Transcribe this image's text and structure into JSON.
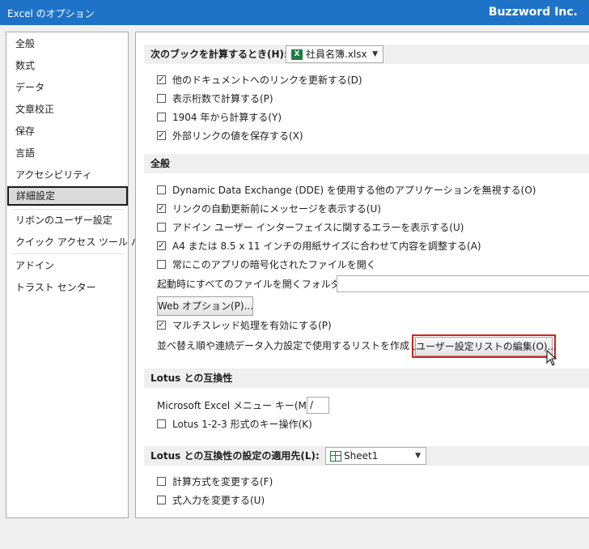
{
  "window": {
    "title": "Excel のオプション",
    "brand": "Buzzword Inc."
  },
  "sidebar": {
    "items": [
      {
        "label": "全般"
      },
      {
        "label": "数式"
      },
      {
        "label": "データ"
      },
      {
        "label": "文章校正"
      },
      {
        "label": "保存"
      },
      {
        "label": "言語"
      },
      {
        "label": "アクセシビリティ"
      },
      {
        "label": "詳細設定",
        "selected": true
      },
      {
        "label": "リボンのユーザー設定"
      },
      {
        "label": "クイック アクセス ツール バー"
      },
      {
        "label": "アドイン"
      },
      {
        "label": "トラスト センター"
      }
    ]
  },
  "workbook_section": {
    "header": "次のブックを計算するとき(H):",
    "workbook_value": "社員名簿.xlsx",
    "options": [
      {
        "label": "他のドキュメントへのリンクを更新する(D)",
        "checked": true
      },
      {
        "label": "表示桁数で計算する(P)",
        "checked": false
      },
      {
        "label": "1904 年から計算する(Y)",
        "checked": false
      },
      {
        "label": "外部リンクの値を保存する(X)",
        "checked": true
      }
    ]
  },
  "general_section": {
    "header": "全般",
    "options": [
      {
        "label": "Dynamic Data Exchange (DDE) を使用する他のアプリケーションを無視する(O)",
        "checked": false
      },
      {
        "label": "リンクの自動更新前にメッセージを表示する(U)",
        "checked": true
      },
      {
        "label": "アドイン ユーザー インターフェイスに関するエラーを表示する(U)",
        "checked": false
      },
      {
        "label": "A4 または 8.5 x 11 インチの用紙サイズに合わせて内容を調整する(A)",
        "checked": true
      },
      {
        "label": "常にこのアプリの暗号化されたファイルを開く",
        "checked": false
      }
    ],
    "startup_folder_label": "起動時にすべてのファイルを開くフォルダー(L):",
    "startup_folder_value": "",
    "web_options_button": "Web オプション(P)...",
    "multithread": {
      "label": "マルチスレッド処理を有効にする(P)",
      "checked": true
    },
    "custom_lists_label": "並べ替え順や連続データ入力設定で使用するリストを作成します:",
    "custom_lists_button": "ユーザー設定リストの編集(O)..."
  },
  "lotus_section": {
    "header": "Lotus との互換性",
    "menu_key_label": "Microsoft Excel メニュー キー(M):",
    "menu_key_value": "/",
    "options": [
      {
        "label": "Lotus 1-2-3 形式のキー操作(K)",
        "checked": false
      }
    ]
  },
  "lotus_settings_section": {
    "header": "Lotus との互換性の設定の適用先(L):",
    "sheet_value": "Sheet1",
    "options": [
      {
        "label": "計算方式を変更する(F)",
        "checked": false
      },
      {
        "label": "式入力を変更する(U)",
        "checked": false
      }
    ]
  },
  "check_glyph": "✓",
  "colors": {
    "titlebar": "#1e73c8",
    "focus_outline": "#d51f1f",
    "excel_green": "#1f7a43"
  }
}
